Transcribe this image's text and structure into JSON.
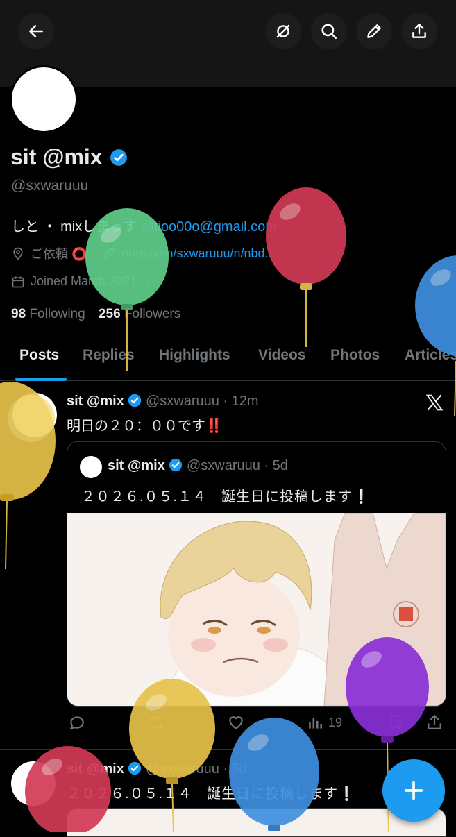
{
  "profile": {
    "name": "sit @mix",
    "handle": "@sxwaruuu",
    "bio_text": "しと ・ mixしまっす ",
    "bio_email": "siitioo00o@gmail.com",
    "location": "ご依頼 ⭕",
    "website": "note.com/sxwaruuu/n/nbd...",
    "joined": "Joined March 2021",
    "following_count": "98",
    "following_label": "Following",
    "followers_count": "256",
    "followers_label": "Followers"
  },
  "tabs": [
    "Posts",
    "Replies",
    "Highlights",
    "Videos",
    "Photos",
    "Articles"
  ],
  "post1": {
    "name": "sit @mix",
    "handle": "@sxwaruuu",
    "time": "· 12m",
    "text": "明日の２０：００です‼️",
    "quote": {
      "name": "sit @mix",
      "handle": "@sxwaruuu",
      "time": "· 5d",
      "text": "２０２６.０５.１４　誕生日に投稿します❕"
    },
    "views": "19"
  },
  "post2": {
    "name": "sit @mix",
    "handle": "@sxwaruuu",
    "time": "· 5d",
    "text": "２０２６.０５.１４　誕生日に投稿します❕"
  },
  "colors": {
    "accent": "#1d9bf0",
    "verified": "#1d9bf0",
    "balloon_green": "#5fcf8a",
    "balloon_red": "#d33a55",
    "balloon_blue": "#3f8fe0",
    "balloon_yellow": "#e6c24a",
    "balloon_purple": "#8a2fd6"
  },
  "icons": [
    "back-arrow-icon",
    "blocked-icon",
    "search-icon",
    "edit-icon",
    "share-icon",
    "verified-icon",
    "location-icon",
    "link-icon",
    "calendar-icon",
    "chevron-right-icon",
    "x-logo-icon",
    "reply-icon",
    "repost-icon",
    "like-icon",
    "views-icon",
    "bookmark-icon",
    "plus-icon"
  ]
}
